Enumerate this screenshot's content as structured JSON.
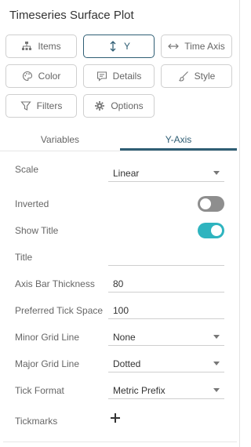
{
  "panel": {
    "title": "Timeseries Surface Plot"
  },
  "buttons": {
    "items": {
      "label": "Items",
      "icon": "hierarchy-icon"
    },
    "y": {
      "label": "Y",
      "icon": "vertical-arrows-icon"
    },
    "time_axis": {
      "label": "Time Axis",
      "icon": "horizontal-arrows-icon"
    },
    "color": {
      "label": "Color",
      "icon": "palette-icon"
    },
    "details": {
      "label": "Details",
      "icon": "comment-icon"
    },
    "style": {
      "label": "Style",
      "icon": "brush-icon"
    },
    "filters": {
      "label": "Filters",
      "icon": "funnel-icon"
    },
    "options": {
      "label": "Options",
      "icon": "gear-icon"
    }
  },
  "tabs": [
    {
      "label": "Variables",
      "active": false
    },
    {
      "label": "Y-Axis",
      "active": true
    }
  ],
  "settings": {
    "scale": {
      "label": "Scale",
      "value": "Linear"
    },
    "inverted": {
      "label": "Inverted",
      "on": false
    },
    "show_title": {
      "label": "Show Title",
      "on": true
    },
    "title": {
      "label": "Title",
      "value": ""
    },
    "axis_bar_thickness": {
      "label": "Axis Bar Thickness",
      "value": "80"
    },
    "preferred_tick_space": {
      "label": "Preferred Tick Space",
      "value": "100"
    },
    "minor_grid_line": {
      "label": "Minor Grid Line",
      "value": "None"
    },
    "major_grid_line": {
      "label": "Major Grid Line",
      "value": "Dotted"
    },
    "tick_format": {
      "label": "Tick Format",
      "value": "Metric Prefix"
    },
    "tickmarks": {
      "label": "Tickmarks"
    }
  },
  "colors": {
    "accent": "#2f5e74",
    "toggle_on": "#2fb4bf",
    "toggle_off": "#8e8e8e"
  }
}
